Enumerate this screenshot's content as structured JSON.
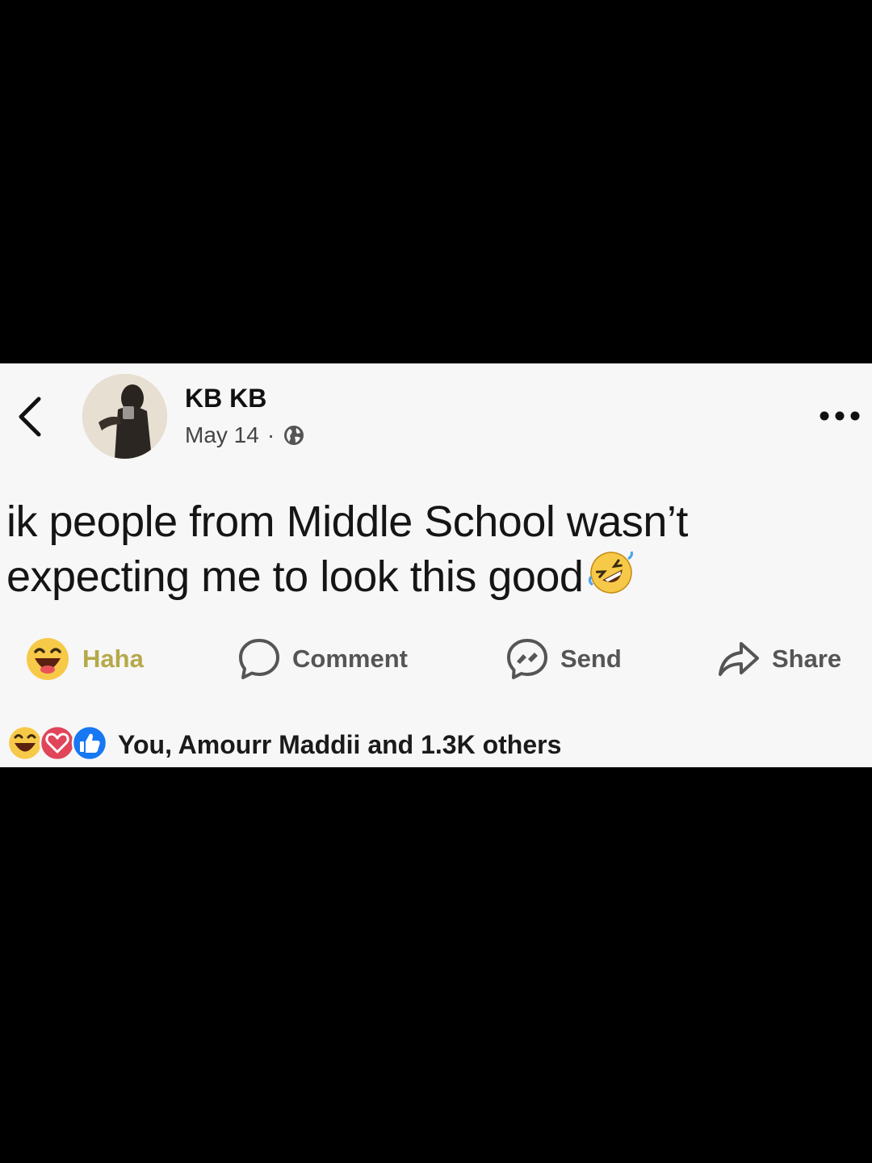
{
  "post": {
    "author": "KB KB",
    "date": "May 14",
    "separator": "·",
    "text": "ik people from Middle School wasn’t expecting me to look this good",
    "text_emoji": "rolling-on-floor-laughing-emoji"
  },
  "actions": {
    "reaction_label": "Haha",
    "comment_label": "Comment",
    "send_label": "Send",
    "share_label": "Share"
  },
  "reactions": {
    "summary": "You, Amourr Maddii and 1.3K others",
    "icons": [
      "haha-icon",
      "love-icon",
      "like-icon"
    ]
  },
  "colors": {
    "card_background": "#f7f7f7",
    "haha_label": "#b5a94a",
    "like_blue": "#1877f2",
    "love_red": "#e0455a",
    "haha_yellow": "#f7c948"
  }
}
